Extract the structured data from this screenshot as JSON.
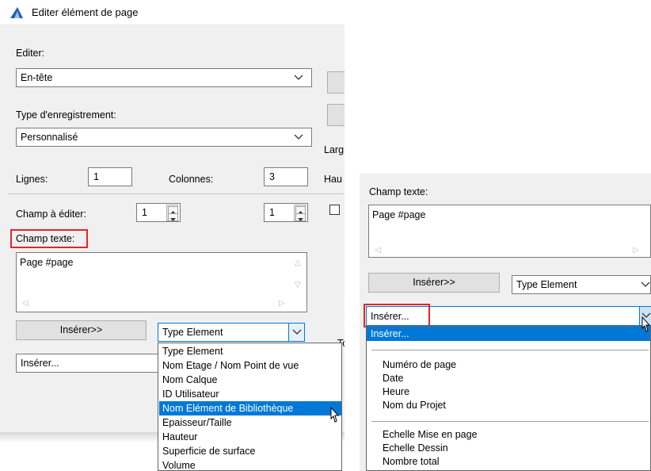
{
  "colors": {
    "accent": "#0078d7",
    "highlight_red": "#e0262b",
    "dialog_bg": "#f0f0f0"
  },
  "left": {
    "window_title": "Editer élément de page",
    "edit_label": "Editer:",
    "edit_value": "En-tête",
    "record_type_label": "Type d'enregistrement:",
    "record_type_value": "Personnalisé",
    "lines_label": "Lignes:",
    "lines_value": "1",
    "columns_label": "Colonnes:",
    "columns_value": "3",
    "field_to_edit_label": "Champ à éditer:",
    "field_to_edit_value": "1",
    "field_to_edit_value2": "1",
    "text_field_label": "Champ texte:",
    "text_field_value": "Page #page",
    "insert_button": "Insérer>>",
    "type_combo_value": "Type Element",
    "insert_combo_value": "Insérer...",
    "right_cut_labels": {
      "larg": "Larg",
      "hau": "Hau",
      "to": "To"
    },
    "dropdown_items": [
      "Type Element",
      "Nom Etage / Nom Point de vue",
      "Nom Calque",
      "ID Utilisateur",
      "Nom Elément de Bibliothèque",
      "Epaisseur/Taille",
      "Hauteur",
      "Superficie de surface",
      "Volume"
    ],
    "dropdown_selected": "Nom Elément de Bibliothèque"
  },
  "right": {
    "text_field_label": "Champ texte:",
    "text_field_value": "Page #page",
    "insert_button": "Insérer>>",
    "type_combo_value": "Type Element",
    "insert_combo_value": "Insérer...",
    "list_selected": "Insérer...",
    "list_group1": [
      "Numéro de page",
      "Date",
      "Heure",
      "Nom du Projet"
    ],
    "list_group2": [
      "Echelle Mise en page",
      "Echelle Dessin",
      "Nombre total"
    ]
  }
}
